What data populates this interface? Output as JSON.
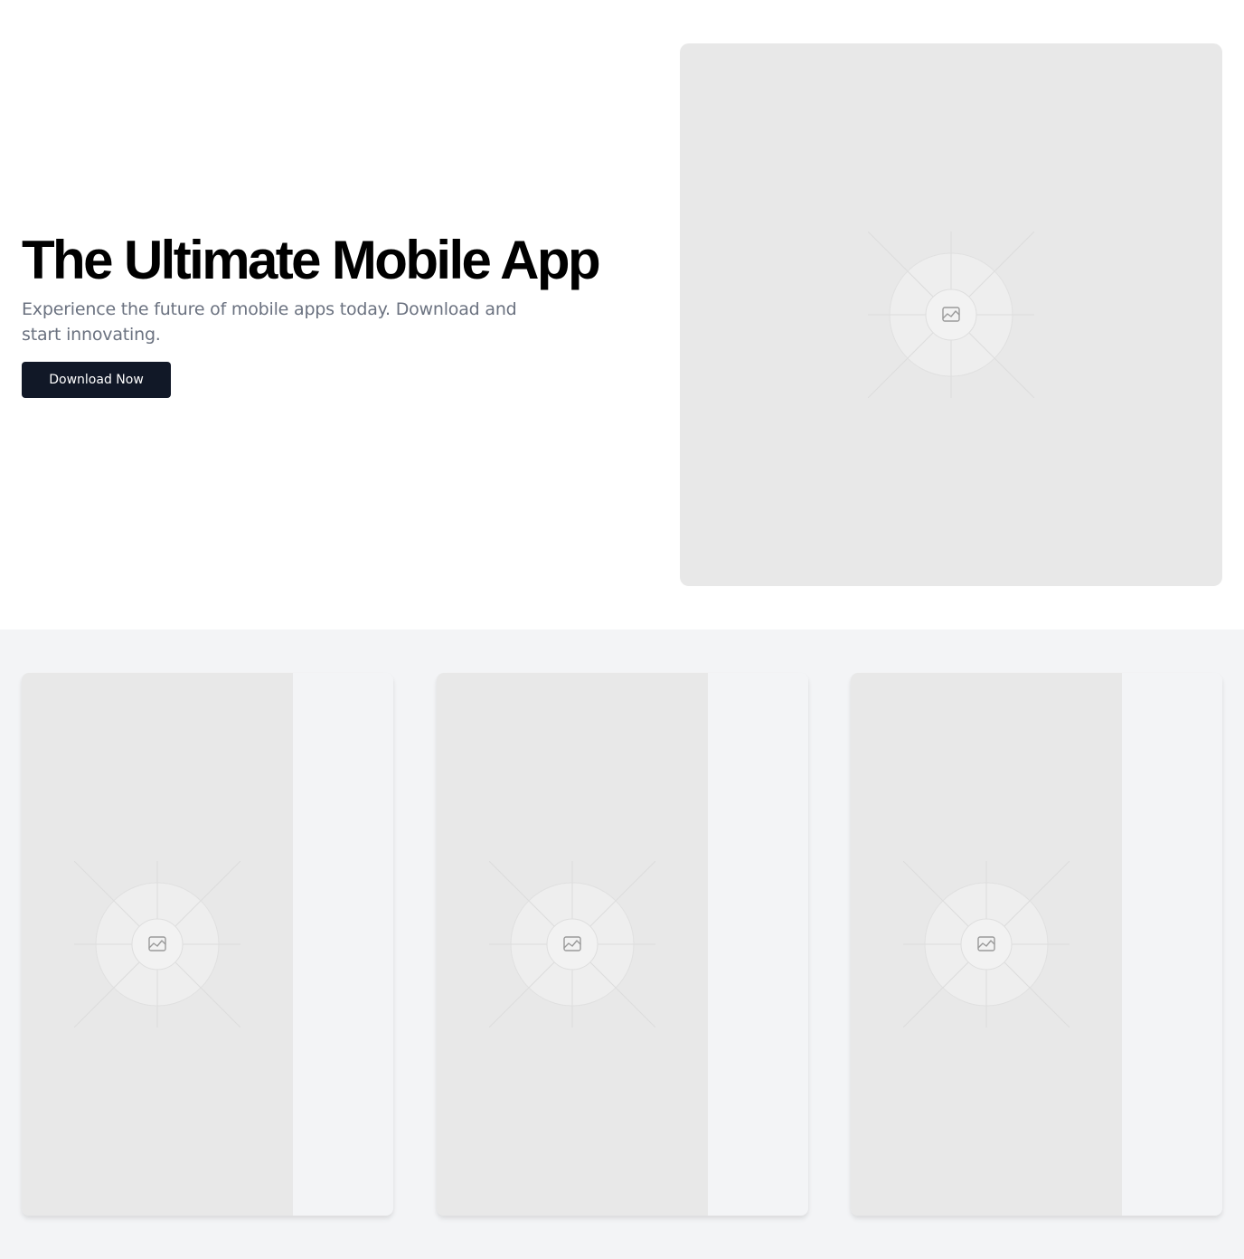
{
  "hero": {
    "title": "The Ultimate Mobile App",
    "subtitle": "Experience the future of mobile apps today. Download and start innovating.",
    "cta_label": "Download Now",
    "image_icon": "image-placeholder-icon"
  },
  "features": {
    "cards": [
      {
        "image_icon": "image-placeholder-icon"
      },
      {
        "image_icon": "image-placeholder-icon"
      },
      {
        "image_icon": "image-placeholder-icon"
      }
    ]
  },
  "colors": {
    "page_background": "#ffffff",
    "section_background": "#f3f4f6",
    "placeholder_background": "#e8e8e8",
    "button_background": "#111827",
    "button_text": "#ffffff",
    "title_text": "#000000",
    "subtitle_text": "#6b7280"
  }
}
